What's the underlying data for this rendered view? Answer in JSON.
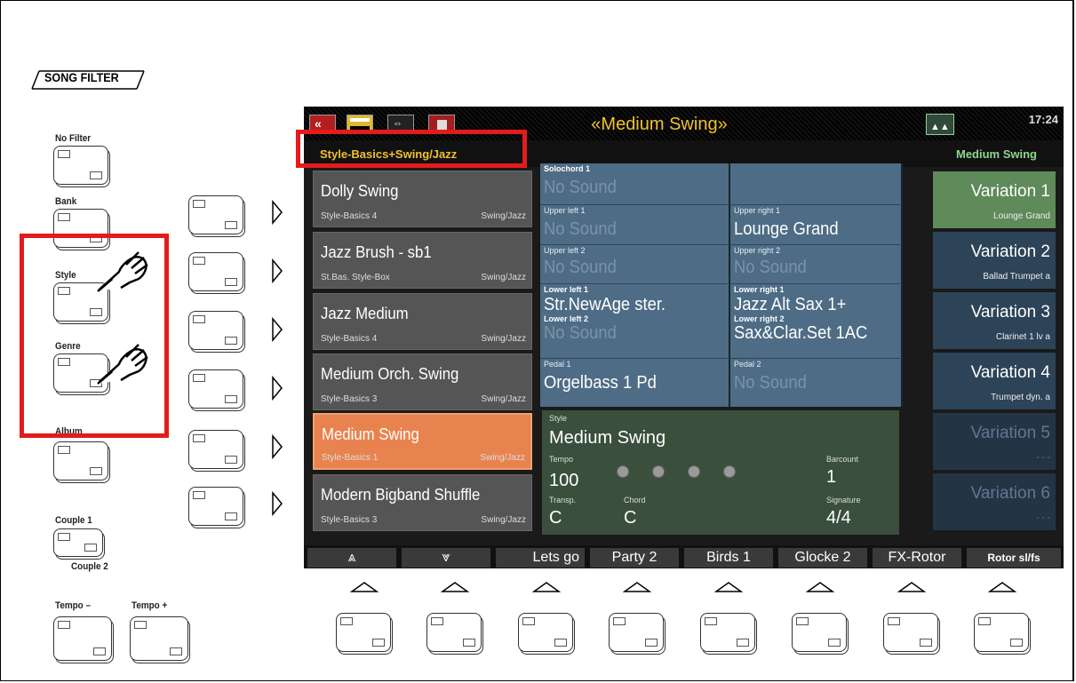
{
  "panel": {
    "section_title": "SONG FILTER",
    "no_filter": "No Filter",
    "bank": "Bank",
    "style": "Style",
    "genre": "Genre",
    "album": "Album",
    "couple1": "Couple 1",
    "couple2": "Couple 2",
    "tempo_minus": "Tempo –",
    "tempo_plus": "Tempo +"
  },
  "screen": {
    "title": "«Medium Swing»",
    "clock": "17:24",
    "filter_header": "Style-Basics+Swing/Jazz",
    "current_style": "Medium Swing",
    "icons": [
      "back-icon",
      "menu-icon",
      "usb-icon",
      "delete-icon",
      "shift-icon"
    ],
    "styles": [
      {
        "name": "Dolly Swing",
        "bank": "Style-Basics 4",
        "genre": "Swing/Jazz"
      },
      {
        "name": "Jazz Brush - sb1",
        "bank": "St.Bas. Style-Box",
        "genre": "Swing/Jazz"
      },
      {
        "name": "Jazz Medium",
        "bank": "Style-Basics 4",
        "genre": "Swing/Jazz"
      },
      {
        "name": "Medium Orch. Swing",
        "bank": "Style-Basics 3",
        "genre": "Swing/Jazz"
      },
      {
        "name": "Medium Swing",
        "bank": "Style-Basics 1",
        "genre": "Swing/Jazz"
      },
      {
        "name": "Modern Bigband Shuffle",
        "bank": "Style-Basics 3",
        "genre": "Swing/Jazz"
      }
    ],
    "sounds": {
      "solochord1": {
        "label": "Solochord 1",
        "value": "No Sound"
      },
      "upper_left1": {
        "label": "Upper left 1",
        "value": "No Sound"
      },
      "upper_right1": {
        "label": "Upper right 1",
        "value": "Lounge Grand"
      },
      "upper_left2": {
        "label": "Upper left 2",
        "value": "No Sound"
      },
      "upper_right2": {
        "label": "Upper right 2",
        "value": "No Sound"
      },
      "lower_left1": {
        "label": "Lower left 1",
        "value": "Str.NewAge ster."
      },
      "lower_right1": {
        "label": "Lower right 1",
        "value": "Jazz Alt Sax 1+"
      },
      "lower_left2": {
        "label": "Lower left 2",
        "value": "No Sound"
      },
      "lower_right2": {
        "label": "Lower right 2",
        "value": "Sax&Clar.Set 1AC"
      },
      "pedal1": {
        "label": "Pedal 1",
        "value": "Orgelbass 1  Pd"
      },
      "pedal2": {
        "label": "Pedal 2",
        "value": "No Sound"
      }
    },
    "info": {
      "style_label": "Style",
      "style_value": "Medium Swing",
      "tempo_label": "Tempo",
      "tempo_value": "100",
      "barcount_label": "Barcount",
      "barcount_value": "1",
      "transp_label": "Transp.",
      "transp_value": "C",
      "chord_label": "Chord",
      "chord_value": "C",
      "signature_label": "Signature",
      "signature_value": "4/4"
    },
    "variations": [
      {
        "name": "Variation 1",
        "detail": "Lounge Grand"
      },
      {
        "name": "Variation 2",
        "detail": "Ballad Trumpet a"
      },
      {
        "name": "Variation 3",
        "detail": "Clarinet 1 lv  a"
      },
      {
        "name": "Variation 4",
        "detail": "Trumpet dyn.  a"
      },
      {
        "name": "Variation 5",
        "detail": "- - -"
      },
      {
        "name": "Variation 6",
        "detail": "- - -"
      }
    ],
    "function_keys": [
      "⩓",
      "⩔",
      "Lets go",
      "Party 2",
      "Birds 1",
      "Glocke 2",
      "FX-Rotor",
      "Rotor sl/fs"
    ]
  },
  "colors": {
    "highlight_red": "#e41b1b",
    "title_yellow": "#f0c030",
    "selected_style": "#e8834f",
    "active_variation": "#5f8a5a",
    "variation_blue": "#2d4358"
  }
}
